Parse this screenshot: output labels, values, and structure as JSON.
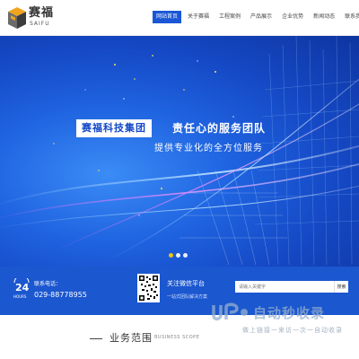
{
  "header": {
    "logo_cn": "赛福",
    "logo_en": "SAIFU",
    "nav": [
      {
        "label": "网站首页",
        "active": true
      },
      {
        "label": "关于赛福",
        "active": false
      },
      {
        "label": "工程案例",
        "active": false
      },
      {
        "label": "产品展示",
        "active": false
      },
      {
        "label": "企业优势",
        "active": false
      },
      {
        "label": "新闻动态",
        "active": false
      },
      {
        "label": "联系我们",
        "active": false
      }
    ]
  },
  "banner": {
    "company_tag": "赛福科技集团",
    "slogan": "责任心的服务团队",
    "sub_slogan": "提供专业化的全方位服务",
    "slide_count": 3,
    "active_slide": 1
  },
  "infobar": {
    "phone_title": "联系电话：",
    "phone_number": "029-88778955",
    "phone_badge": "24",
    "phone_badge_sub": "HOURS",
    "wechat_title": "关注微信平台",
    "wechat_sub": "一站式团队解决方案",
    "search_placeholder": "请输入关键字",
    "search_button": "搜索"
  },
  "watermark": {
    "text": "自动秒收录",
    "sub": "做上链接一来访一次一自动收录"
  },
  "section": {
    "title": "业务范围",
    "title_en": "BUSINESS SCOPE"
  },
  "colors": {
    "brand_blue": "#1b57cf",
    "nav_active": "#1a56d6",
    "banner_deep": "#0e35a0",
    "accent_yellow": "#ffd200"
  }
}
